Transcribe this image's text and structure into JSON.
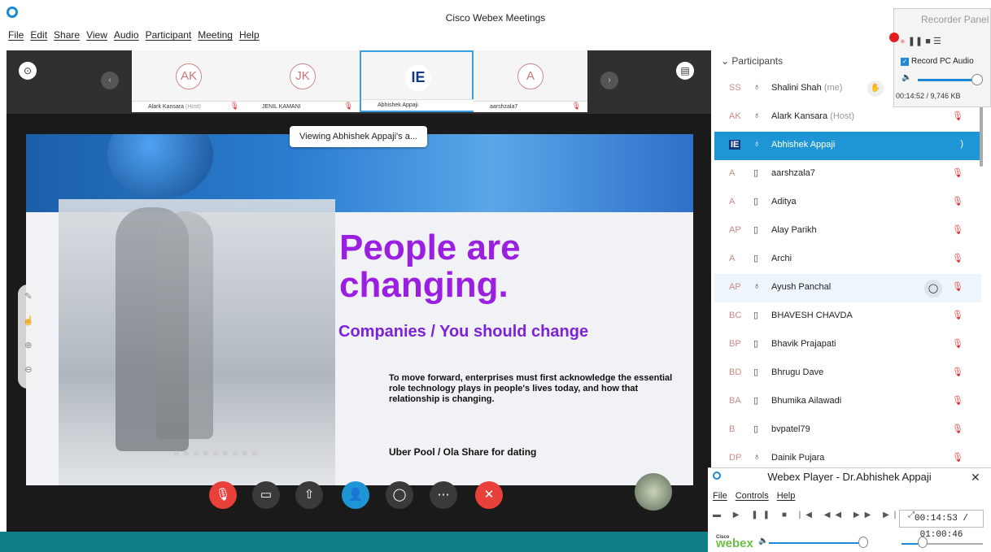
{
  "window": {
    "title": "Cisco Webex Meetings"
  },
  "menu": [
    "File",
    "Edit",
    "Share",
    "View",
    "Audio",
    "Participant",
    "Meeting",
    "Help"
  ],
  "thumbnails": [
    {
      "initials": "AK",
      "name": "Alark Kansara",
      "role": "(Host)"
    },
    {
      "initials": "JK",
      "name": "JENIL KAMANI",
      "role": ""
    },
    {
      "initials": "IE",
      "name": "Abhishek Appaji",
      "role": ""
    },
    {
      "initials": "A",
      "name": "aarshzala7",
      "role": ""
    }
  ],
  "viewing_tip": "Viewing Abhishek Appaji's a...",
  "slide": {
    "headline": "People are changing.",
    "subheadline": "Companies / You should change",
    "body": "To move forward, enterprises must first acknowledge the essential role technology plays in people's lives today, and how that relationship is changing.",
    "bottom": "Uber Pool / Ola Share for dating"
  },
  "participants": {
    "header": "Participants",
    "rows": [
      {
        "initials": "SS",
        "name": "Shalini Shah",
        "suffix": "(me)"
      },
      {
        "initials": "AK",
        "name": "Alark Kansara",
        "suffix": "(Host)"
      },
      {
        "initials": "IE",
        "name": "Abhishek Appaji",
        "suffix": ""
      },
      {
        "initials": "A",
        "name": "aarshzala7",
        "suffix": ""
      },
      {
        "initials": "A",
        "name": "Aditya",
        "suffix": ""
      },
      {
        "initials": "AP",
        "name": "Alay Parikh",
        "suffix": ""
      },
      {
        "initials": "A",
        "name": "Archi",
        "suffix": ""
      },
      {
        "initials": "AP",
        "name": "Ayush Panchal",
        "suffix": ""
      },
      {
        "initials": "BC",
        "name": "BHAVESH CHAVDA",
        "suffix": ""
      },
      {
        "initials": "BP",
        "name": "Bhavik Prajapati",
        "suffix": ""
      },
      {
        "initials": "BD",
        "name": "Bhrugu Dave",
        "suffix": ""
      },
      {
        "initials": "BA",
        "name": "Bhumika Ailawadi",
        "suffix": ""
      },
      {
        "initials": "B",
        "name": "bvpatel79",
        "suffix": ""
      },
      {
        "initials": "DP",
        "name": "Dainik Pujara",
        "suffix": ""
      }
    ]
  },
  "recorder": {
    "title": "Recorder Panel",
    "record_audio": "Record PC Audio",
    "time": "00:14:52 / 9,746 KB"
  },
  "player": {
    "title": "Webex Player - Dr.Abhishek Appaji",
    "menu": [
      "File",
      "Controls",
      "Help"
    ],
    "time": "00:14:53 / 01:00:46",
    "brand_top": "Cisco",
    "brand": "webex"
  },
  "colors": {
    "accent": "#1e96d6",
    "end_call": "#e8403a",
    "slide_purple": "#9a1fe0"
  }
}
